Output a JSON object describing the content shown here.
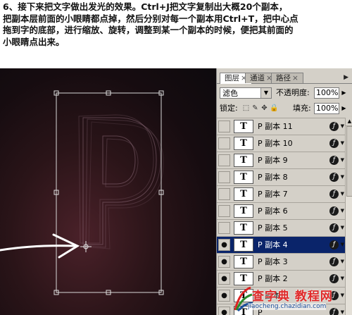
{
  "instructions": {
    "line1": "6、接下来把文字做出发光的效果。Ctrl+J把文字复制出大概20个副本，",
    "line2": "把副本层前面的小眼睛都点掉，然后分别对每一个副本用Ctrl+T，把中心点",
    "line3": "拖到字的底部，进行缩放、旋转，调整到某一个副本的时候，便把其前面的",
    "line4": "小眼睛点出来。"
  },
  "panel": {
    "tabs": [
      "图层",
      "通道",
      "路径"
    ],
    "tab_close": "×",
    "menu_arrow": "▶",
    "blend_mode": "滤色",
    "opacity_label": "不透明度:",
    "opacity_value": "100%",
    "lock_label": "锁定:",
    "fill_label": "填充:",
    "fill_value": "100%",
    "layers": [
      {
        "name": "P 副本 11",
        "visible": false,
        "selected": false
      },
      {
        "name": "P 副本 10",
        "visible": false,
        "selected": false
      },
      {
        "name": "P 副本 9",
        "visible": false,
        "selected": false
      },
      {
        "name": "P 副本 8",
        "visible": false,
        "selected": false
      },
      {
        "name": "P 副本 7",
        "visible": false,
        "selected": false
      },
      {
        "name": "P 副本 6",
        "visible": false,
        "selected": false
      },
      {
        "name": "P 副本 5",
        "visible": false,
        "selected": false
      },
      {
        "name": "P 副本 4",
        "visible": true,
        "selected": true
      },
      {
        "name": "P 副本 3",
        "visible": true,
        "selected": false
      },
      {
        "name": "P 副本 2",
        "visible": true,
        "selected": false
      },
      {
        "name": "P 副本",
        "visible": true,
        "selected": false
      },
      {
        "name": "P",
        "visible": true,
        "selected": false
      }
    ],
    "thumb_glyph": "T",
    "fx_glyph": "ƒ",
    "eye_glyph": "👁"
  },
  "watermark": {
    "text": "查字典 教程网",
    "url": "jiaocheng.chazidian.com"
  },
  "colors": {
    "selection": "#0a246a",
    "panel_bg": "#d4d0c8",
    "watermark_red": "#e02a2a"
  }
}
